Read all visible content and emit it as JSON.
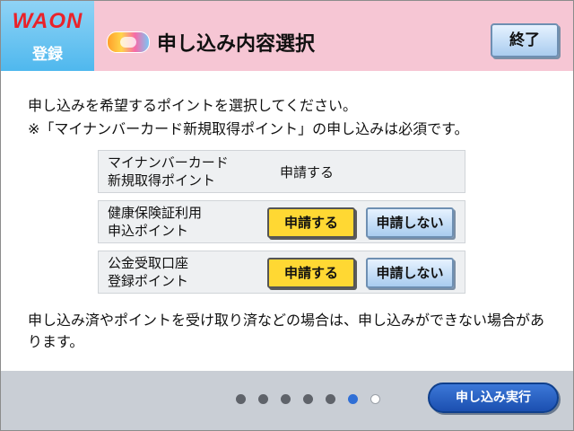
{
  "header": {
    "brand_logo": "WAON",
    "brand_sub": "登録",
    "title": "申し込み内容選択",
    "end_label": "終了",
    "mynapoint_icon": "mynapoint-logo-icon"
  },
  "instructions": {
    "line1": "申し込みを希望するポイントを選択してください。",
    "line2": "※「マイナンバーカード新規取得ポイント」の申し込みは必須です。"
  },
  "points": [
    {
      "label_line1": "マイナンバーカード",
      "label_line2": "新規取得ポイント",
      "value": "申請する"
    },
    {
      "label_line1": "健康保険証利用",
      "label_line2": "申込ポイント",
      "apply_label": "申請する",
      "noapply_label": "申請しない",
      "selected": "apply"
    },
    {
      "label_line1": "公金受取口座",
      "label_line2": "登録ポイント",
      "apply_label": "申請する",
      "noapply_label": "申請しない",
      "selected": "apply"
    }
  ],
  "note": "申し込み済やポイントを受け取り済などの場合は、申し込みができない場合があります。",
  "footer": {
    "page_total": 7,
    "page_current": 6,
    "exec_label": "申し込み実行"
  },
  "colors": {
    "title_bar": "#f6c6d4",
    "brand_tile": "#4fb8ee",
    "apply_button": "#ffd833",
    "noapply_button": "#a9ccef",
    "exec_button": "#1b4fb0",
    "footer": "#c9ced5"
  }
}
